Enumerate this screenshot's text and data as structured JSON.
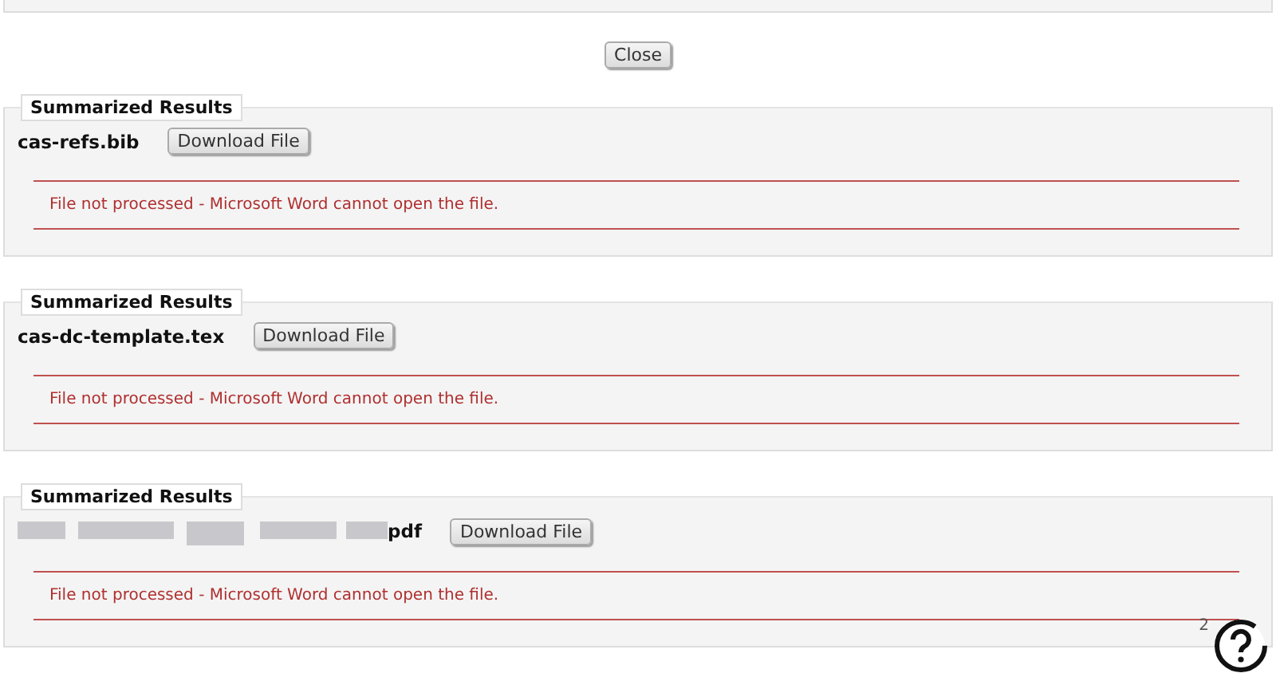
{
  "close_button": "Close",
  "results": [
    {
      "legend": "Summarized Results",
      "file_name": "cas-refs.bib",
      "redacted": false,
      "download_button": "Download File",
      "message": "File not processed - Microsoft Word cannot open the file."
    },
    {
      "legend": "Summarized Results",
      "file_name": "cas-dc-template.tex",
      "redacted": false,
      "download_button": "Download File",
      "message": "File not processed - Microsoft Word cannot open the file."
    },
    {
      "legend": "Summarized Results",
      "file_name": "pdf",
      "redacted": true,
      "download_button": "Download File",
      "message": "File not processed - Microsoft Word cannot open the file."
    }
  ],
  "help": {
    "badge": "2"
  }
}
